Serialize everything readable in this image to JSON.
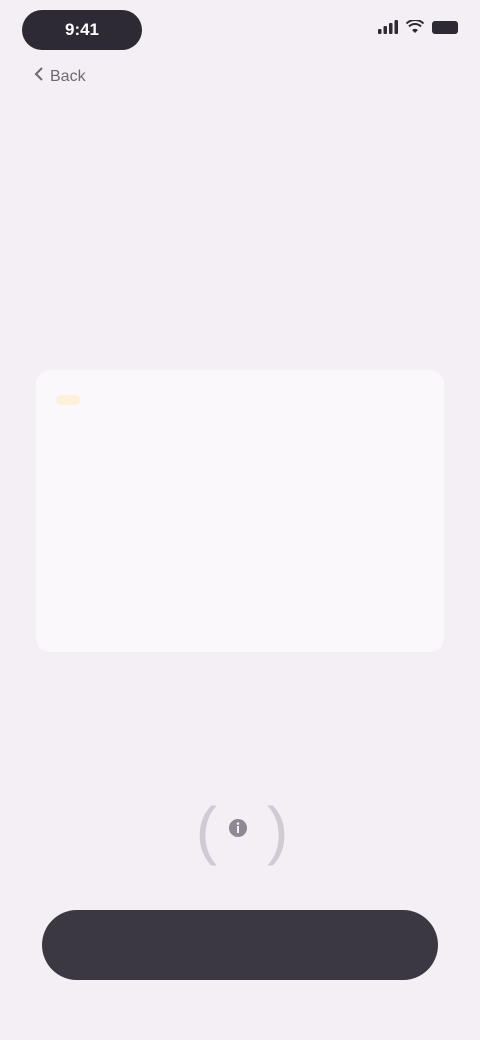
{
  "status_bar": {
    "time": "9:41"
  },
  "nav": {
    "back_label": "Back"
  },
  "page": {
    "title": ""
  },
  "info_card": {
    "tag": "",
    "body": "",
    "note": ""
  },
  "help": {
    "label": ""
  },
  "primary_button": {
    "label": ""
  },
  "colors": {
    "background": "#f4eff5",
    "card": "#fbf8fb",
    "tag_text": "#d9a23a",
    "tag_bg": "#fdf1dc",
    "note_text": "#7aa58a",
    "button_bg": "#3b3842"
  }
}
